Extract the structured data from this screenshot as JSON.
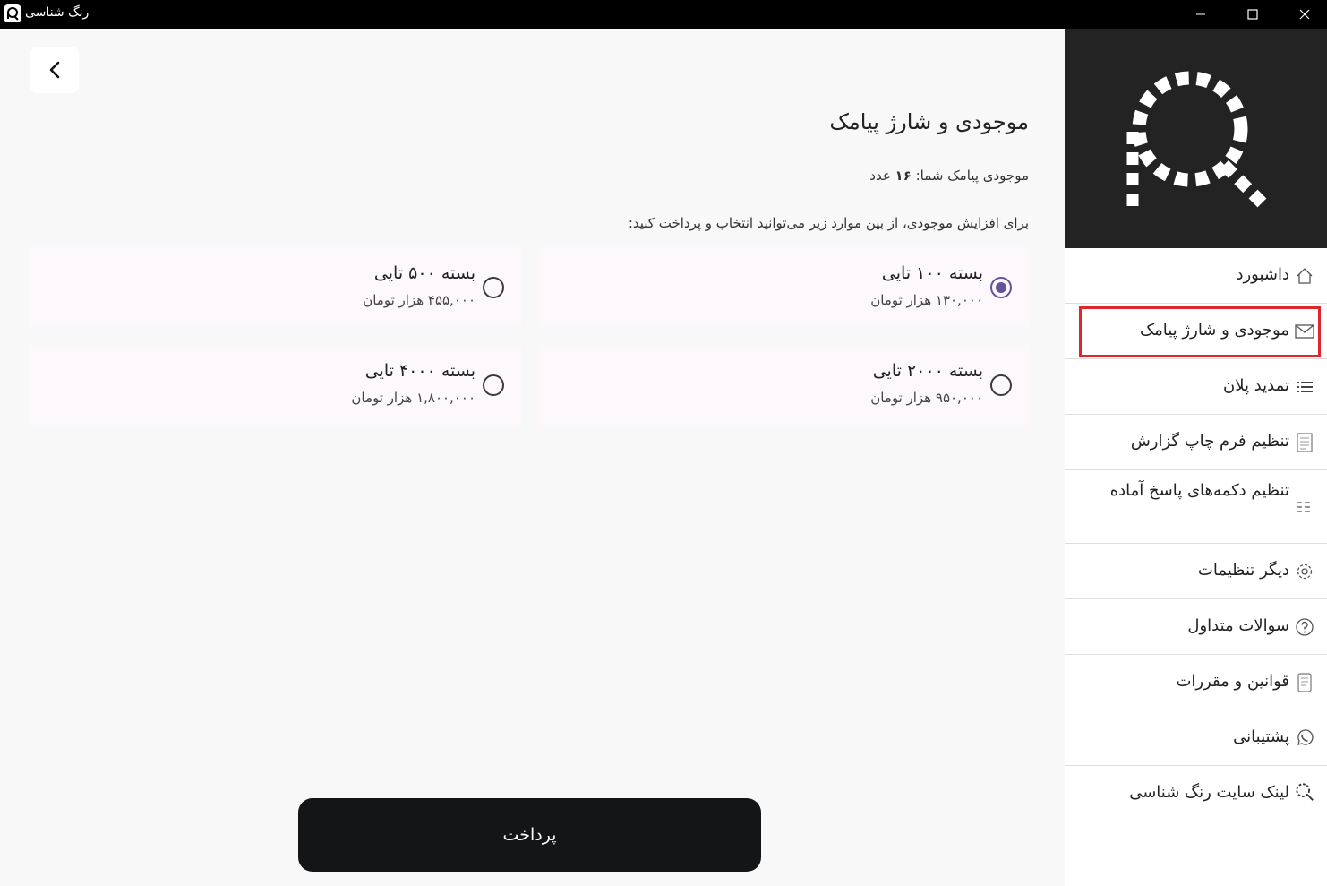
{
  "window": {
    "title": "رنگ شناسی",
    "colors": {
      "titlebar": "#000000",
      "accent": "#63539a",
      "highlight": "#e0262c",
      "pay_button": "#131517"
    }
  },
  "main": {
    "back_icon": "chevron-left-icon",
    "title": "موجودی و شارژ پیامک",
    "balance_label": "موجودی پیامک شما: ",
    "balance_value": "۱۶",
    "balance_unit": " عدد",
    "instruction": "برای افزایش موجودی، از بین موارد زیر می‌توانید انتخاب و پرداخت کنید:",
    "packages": [
      {
        "name": "بسته ۱۰۰ تایی",
        "price": "۱۳۰,۰۰۰ هزار تومان",
        "selected": true
      },
      {
        "name": "بسته ۵۰۰ تایی",
        "price": "۴۵۵,۰۰۰ هزار تومان",
        "selected": false
      },
      {
        "name": "بسته ۲۰۰۰ تایی",
        "price": "۹۵۰,۰۰۰ هزار تومان",
        "selected": false
      },
      {
        "name": "بسته ۴۰۰۰ تایی",
        "price": "۱,۸۰۰,۰۰۰ هزار تومان",
        "selected": false
      }
    ],
    "pay_label": "پرداخت"
  },
  "sidebar": {
    "items": [
      {
        "label": "داشبورد",
        "icon": "home-icon"
      },
      {
        "label": "موجودی و شارژ پیامک",
        "icon": "envelope-icon",
        "active": true
      },
      {
        "label": "تمدید پلان",
        "icon": "list-icon"
      },
      {
        "label": "تنظیم فرم چاپ گزارش",
        "icon": "document-icon"
      },
      {
        "label": "تنظیم دکمه‌های پاسخ آماده",
        "icon": "sliders-icon"
      },
      {
        "label": "دیگر تنظیمات",
        "icon": "gear-icon"
      },
      {
        "label": "سوالات متداول",
        "icon": "question-icon"
      },
      {
        "label": "قوانین و مقررات",
        "icon": "scroll-icon"
      },
      {
        "label": "پشتیبانی",
        "icon": "whatsapp-icon"
      },
      {
        "label": "لینک سایت رنگ شناسی",
        "icon": "magnifier-icon"
      }
    ]
  }
}
